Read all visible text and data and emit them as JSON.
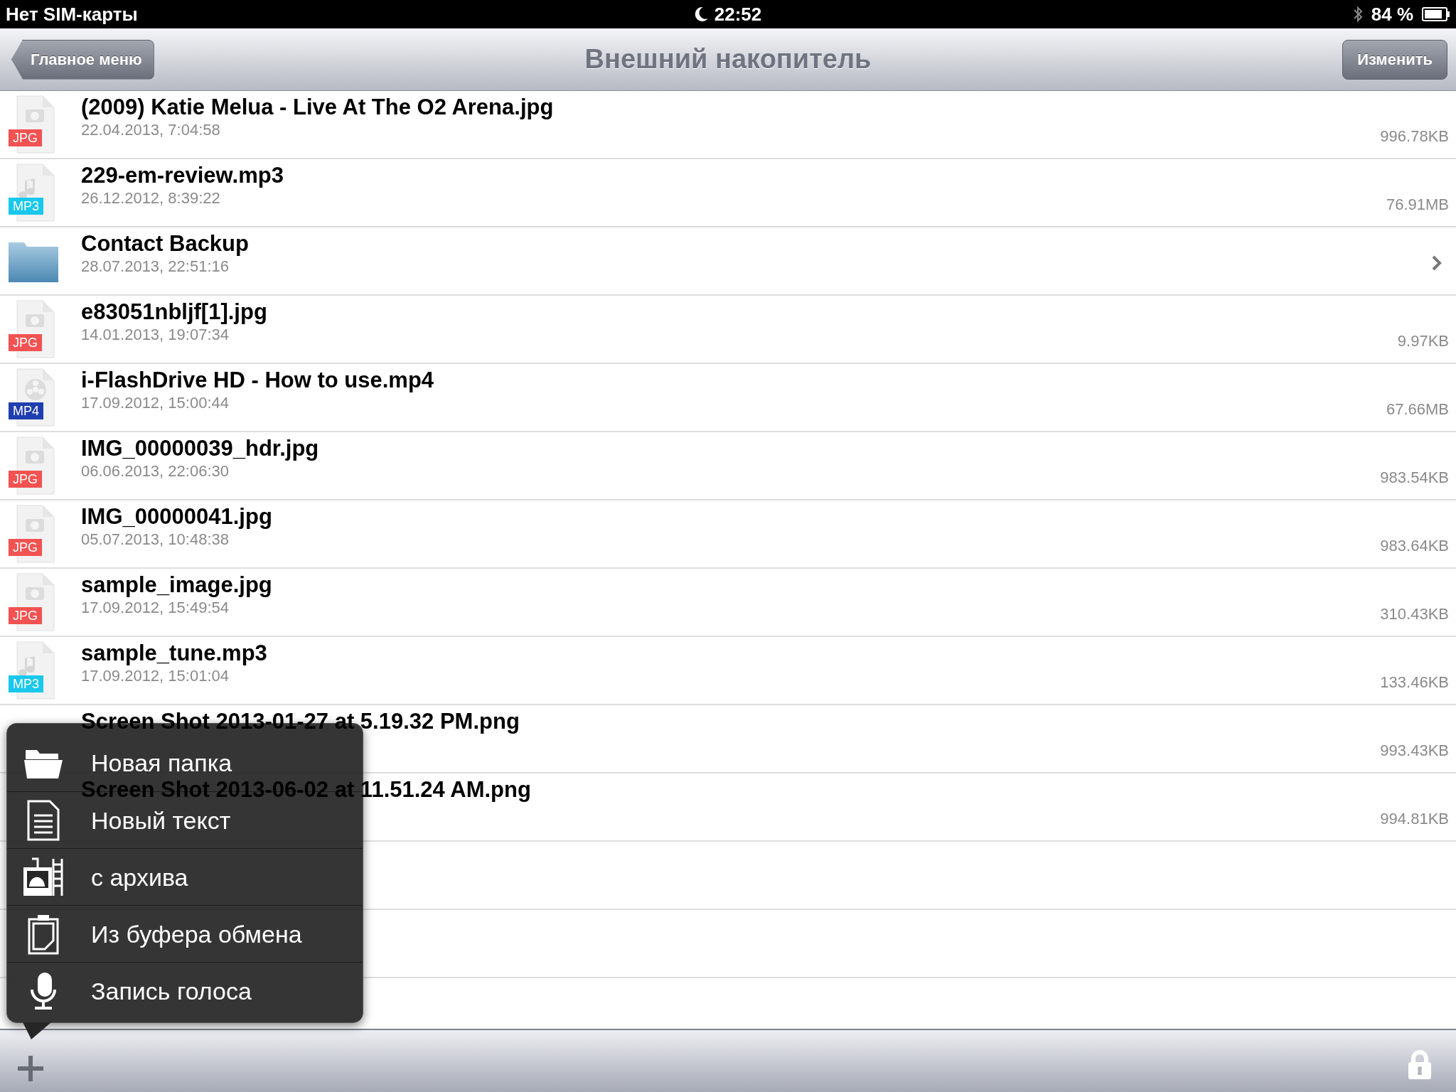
{
  "status_bar": {
    "carrier": "Нет SIM-карты",
    "time": "22:52",
    "battery": "84 %"
  },
  "nav_bar": {
    "back": "Главное меню",
    "title": "Внешний накопитель",
    "edit": "Изменить"
  },
  "files": [
    {
      "kind": "file",
      "badge": "JPG",
      "color": "#f25252",
      "name": "(2009) Katie Melua  - Live At The O2 Arena.jpg",
      "date": "22.04.2013, 7:04:58",
      "size": "996.78KB"
    },
    {
      "kind": "file",
      "badge": "MP3",
      "color": "#19c8ec",
      "name": "229-em-review.mp3",
      "date": "26.12.2012, 8:39:22",
      "size": "76.91MB"
    },
    {
      "kind": "folder",
      "name": "Contact Backup",
      "date": "28.07.2013, 22:51:16"
    },
    {
      "kind": "file",
      "badge": "JPG",
      "color": "#f25252",
      "name": "e83051nbljf[1].jpg",
      "date": "14.01.2013, 19:07:34",
      "size": "9.97KB"
    },
    {
      "kind": "file",
      "badge": "MP4",
      "color": "#1f3fb0",
      "name": "i-FlashDrive HD - How to use.mp4",
      "date": "17.09.2012, 15:00:44",
      "size": "67.66MB"
    },
    {
      "kind": "file",
      "badge": "JPG",
      "color": "#f25252",
      "name": "IMG_00000039_hdr.jpg",
      "date": "06.06.2013, 22:06:30",
      "size": "983.54KB"
    },
    {
      "kind": "file",
      "badge": "JPG",
      "color": "#f25252",
      "name": "IMG_00000041.jpg",
      "date": "05.07.2013, 10:48:38",
      "size": "983.64KB"
    },
    {
      "kind": "file",
      "badge": "JPG",
      "color": "#f25252",
      "name": "sample_image.jpg",
      "date": "17.09.2012, 15:49:54",
      "size": "310.43KB"
    },
    {
      "kind": "file",
      "badge": "MP3",
      "color": "#19c8ec",
      "name": "sample_tune.mp3",
      "date": "17.09.2012, 15:01:04",
      "size": "133.46KB"
    },
    {
      "kind": "covered",
      "name": "Screen Shot 2013-01-27 at 5.19.32 PM.png",
      "size": "993.43KB"
    },
    {
      "kind": "covered",
      "name": "Screen Shot 2013-06-02 at 11.51.24 AM.png",
      "size": "994.81KB"
    }
  ],
  "popup_menu": [
    {
      "kind": "folder",
      "label": "Новая папка"
    },
    {
      "kind": "text",
      "label": "Новый текст"
    },
    {
      "kind": "archive",
      "label": "с архива"
    },
    {
      "kind": "clipboard",
      "label": "Из буфера обмена"
    },
    {
      "kind": "voice",
      "label": "Запись голоса"
    }
  ]
}
